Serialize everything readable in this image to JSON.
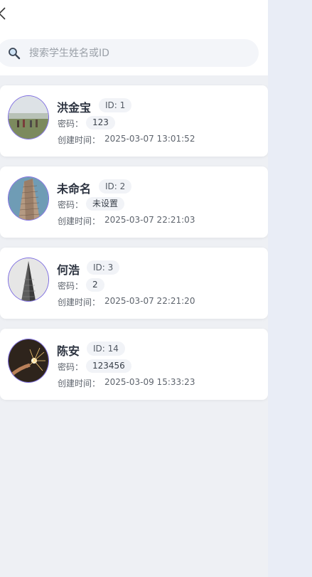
{
  "search": {
    "placeholder": "搜索学生姓名或ID"
  },
  "labels": {
    "password": "密码：",
    "created": "创建时间："
  },
  "students": [
    {
      "name": "洪金宝",
      "id": "ID: 1",
      "password": "123",
      "created": "2025-03-07 13:01:52",
      "avatar": "field-photo"
    },
    {
      "name": "未命名",
      "id": "ID: 2",
      "password": "未设置",
      "created": "2025-03-07 22:21:03",
      "avatar": "building-photo"
    },
    {
      "name": "何浩",
      "id": "ID: 3",
      "password": "2",
      "created": "2025-03-07 22:21:20",
      "avatar": "tower-photo"
    },
    {
      "name": "陈安",
      "id": "ID: 14",
      "password": "123456",
      "created": "2025-03-09 15:33:23",
      "avatar": "sparkler-photo"
    }
  ],
  "colors": {
    "accent": "#7b6ae0",
    "panel_bg": "#eef0f4",
    "card_bg": "#ffffff"
  }
}
